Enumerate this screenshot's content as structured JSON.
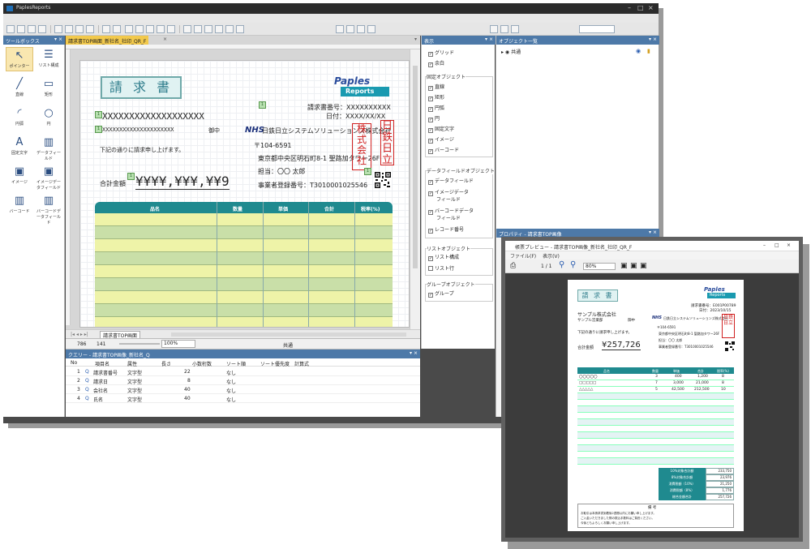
{
  "main_window": {
    "title": "PaplesReports",
    "toolbox_title": "ツールボックス",
    "tools": [
      {
        "label": "ポインター",
        "icon": "pointer-icon",
        "glyph": "↖"
      },
      {
        "label": "リスト構成",
        "icon": "list-icon",
        "glyph": "☰"
      },
      {
        "label": "直線",
        "icon": "line-icon",
        "glyph": "╱"
      },
      {
        "label": "矩形",
        "icon": "rectangle-icon",
        "glyph": "▭"
      },
      {
        "label": "円弧",
        "icon": "arc-icon",
        "glyph": "◜"
      },
      {
        "label": "円",
        "icon": "circle-icon",
        "glyph": "○"
      },
      {
        "label": "固定文字",
        "icon": "text-icon",
        "glyph": "A"
      },
      {
        "label": "データフィールド",
        "icon": "datafield-icon",
        "glyph": "▥"
      },
      {
        "label": "イメージ",
        "icon": "image-icon",
        "glyph": "▣"
      },
      {
        "label": "イメージデータフィールド",
        "icon": "image-datafield-icon",
        "glyph": "▣"
      },
      {
        "label": "バーコード",
        "icon": "barcode-icon",
        "glyph": "▥"
      },
      {
        "label": "バーコードデータフィールド",
        "icon": "barcode-datafield-icon",
        "glyph": "▥"
      }
    ],
    "doc_tab": "請求書TOP画面_新社名_社印_QR_F",
    "sheet_tab": "請求書TOP画面",
    "status": {
      "coord_x": "786",
      "coord_y": "141",
      "zoom": "100%",
      "section": "共通"
    }
  },
  "invoice": {
    "title": "請 求 書",
    "logo_top": "Paples",
    "logo_bottom": "Reports",
    "recipient": "XXXXXXXXXXXXXXXXXXX",
    "recipient_sub": "XXXXXXXXXXXXXXXXXXXXX",
    "honorific": "御中",
    "greeting": "下記の通りに請求申し上げます。",
    "total_label": "合計金額",
    "total_value": "¥¥¥¥,¥¥¥,¥¥9",
    "invoice_no": "請求書番号：XXXXXXXXXX",
    "date": "日付：XXXX/XX/XX",
    "company": "日鉄日立システムソリューションズ株式会社",
    "postal": "〒104-6591",
    "address": "東京都中央区明石町8-1 聖路加タワー26F",
    "person": "担当：〇〇 太郎",
    "reg_no": "事業者登録番号：T3010001025546",
    "stamp_left": "株式会社",
    "stamp_right": "日鉄日立",
    "headers": [
      "品名",
      "数量",
      "単価",
      "合計",
      "税率(%)"
    ]
  },
  "display_panel": {
    "title": "表示",
    "grid": "グリッド",
    "margin": "余白",
    "fixed_group": "固定オブジェクト",
    "fixed_items": [
      "直線",
      "矩形",
      "円弧",
      "円",
      "固定文字",
      "イメージ",
      "バーコード"
    ],
    "data_group": "データフィールドオブジェクト",
    "data_items": [
      "データフィールド",
      "イメージデータ",
      "フィールド",
      "バーコードデータ",
      "フィールド",
      "レコード番号"
    ],
    "list_group": "リストオブジェクト",
    "list_items": [
      "リスト構成",
      "リスト行"
    ],
    "group_group": "グループオブジェクト",
    "group_items": [
      "グループ"
    ]
  },
  "object_panel": {
    "title": "オブジェクト一覧",
    "root": "共通"
  },
  "property_panel": {
    "title": "プロパティ - 請求書TOP画像"
  },
  "query": {
    "title": "クエリー - 請求書TOP画像_新社名_Q",
    "columns": [
      "No",
      "項目名",
      "属性",
      "長さ",
      "小数桁数",
      "ソート順",
      "ソート優先度",
      "計算式"
    ],
    "rows": [
      [
        "1",
        "請求書番号",
        "文字型",
        "22",
        "",
        "なし"
      ],
      [
        "2",
        "請求日",
        "文字型",
        "8",
        "",
        "なし"
      ],
      [
        "3",
        "会社名",
        "文字型",
        "40",
        "",
        "なし"
      ],
      [
        "4",
        "氏名",
        "文字型",
        "40",
        "",
        "なし"
      ]
    ]
  },
  "preview": {
    "title": "帳票プレビュー - 請求書TOP画像_新社名_社印_QR_F",
    "menu": [
      "ファイル(F)",
      "表示(V)"
    ],
    "page": "1 / 1",
    "zoom": "80%",
    "doc": {
      "title": "請 求 書",
      "logo_top": "Paples",
      "logo_bottom": "Reports",
      "customer": "サンプル株式会社",
      "customer_sub": "サンプル営業部",
      "honorific": "御中",
      "greeting": "下記の通りに請求申し上げます。",
      "total_label": "合計金額",
      "total_value": "¥257,726",
      "invoice_no": "請求書番号：E001P00789",
      "date": "日付：2023/10/15",
      "company": "日鉄日立システムソリューションズ株式会社",
      "postal": "〒104-6591",
      "address": "東京都中央区明石町8-1 聖路加タワー26F",
      "person": "担当：〇〇 太郎",
      "reg_no": "事業者登録番号：T3010001025546",
      "headers": [
        "品名",
        "数量",
        "単価",
        "合計",
        "税率(%)"
      ],
      "rows": [
        [
          "〇〇〇〇〇",
          "3",
          "400",
          "1,200",
          "8"
        ],
        [
          "□□□□□",
          "7",
          "3,000",
          "21,000",
          "8"
        ],
        [
          "△△△△△",
          "5",
          "42,500",
          "212,500",
          "10"
        ]
      ],
      "summary": [
        [
          "10%対象合計額",
          "233,750"
        ],
        [
          "8%対象合計額",
          "23,976"
        ],
        [
          "消費税額（10%）",
          "21,250"
        ],
        [
          "消費税額（8%）",
          "1,776"
        ],
        [
          "総合金額合計",
          "257,726"
        ]
      ],
      "notes_title": "備 考",
      "notes": [
        "お取引は本請求書到着後2週間以内にお願い申し上げます。",
        "ご入金いただきました際の振込手数料はご負担ください。",
        "今後ともよろしくお願い申し上げます。"
      ]
    }
  }
}
